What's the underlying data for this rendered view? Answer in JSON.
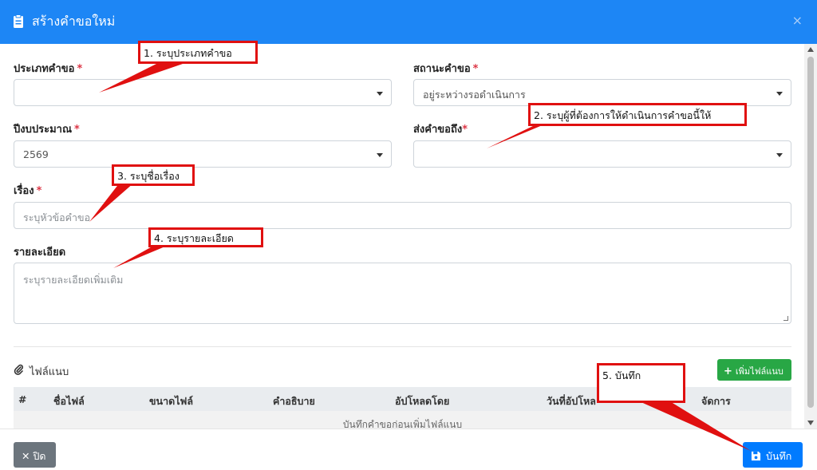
{
  "modal": {
    "title": "สร้างคำขอใหม่",
    "close_glyph": "×"
  },
  "form": {
    "request_type": {
      "label": "ประเภทคำขอ",
      "required_mark": "*",
      "value": ""
    },
    "status": {
      "label": "สถานะคำขอ",
      "required_mark": "*",
      "value": "อยู่ระหว่างรอดำเนินการ"
    },
    "budget_year": {
      "label": "ปีงบประมาณ",
      "required_mark": "*",
      "value": "2569"
    },
    "send_to": {
      "label": "ส่งคำขอถึง",
      "required_mark": "*",
      "value": ""
    },
    "subject": {
      "label": "เรื่อง",
      "required_mark": "*",
      "placeholder": "ระบุหัวข้อคำขอ"
    },
    "details": {
      "label": "รายละเอียด",
      "placeholder": "ระบุรายละเอียดเพิ่มเติม"
    }
  },
  "attachments": {
    "title": "ไฟล์แนบ",
    "add_button": "เพิ่มไฟล์แนบ",
    "columns": [
      "#",
      "ชื่อไฟล์",
      "ขนาดไฟล์",
      "คำอธิบาย",
      "อัปโหลดโดย",
      "วันที่อัปโหล",
      "จัดการ"
    ],
    "empty_message": "บันทึกคำขอก่อนเพิ่มไฟล์แนบ"
  },
  "footer": {
    "close_label": "ปิด",
    "save_label": "บันทึก"
  },
  "annotations": [
    "1. ระบุประเภทคำขอ",
    "2. ระบุผู้ที่ต้องการให้ดำเนินการคำขอนี้ให้",
    "3. ระบุชื่อเรื่อง",
    "4. ระบุรายละเอียด",
    "5. บันทึก"
  ],
  "colors": {
    "header": "#1d86f5",
    "required": "#dc3545",
    "add_button": "#28a745",
    "save_button": "#007bff",
    "close_button": "#6c757d",
    "annotation": "#e01010"
  },
  "icons": {
    "title": "clipboard-icon",
    "close": "close-icon",
    "attachment": "paperclip-icon",
    "add": "plus-icon",
    "footer_close": "x-icon",
    "save": "floppy-disk-icon"
  }
}
